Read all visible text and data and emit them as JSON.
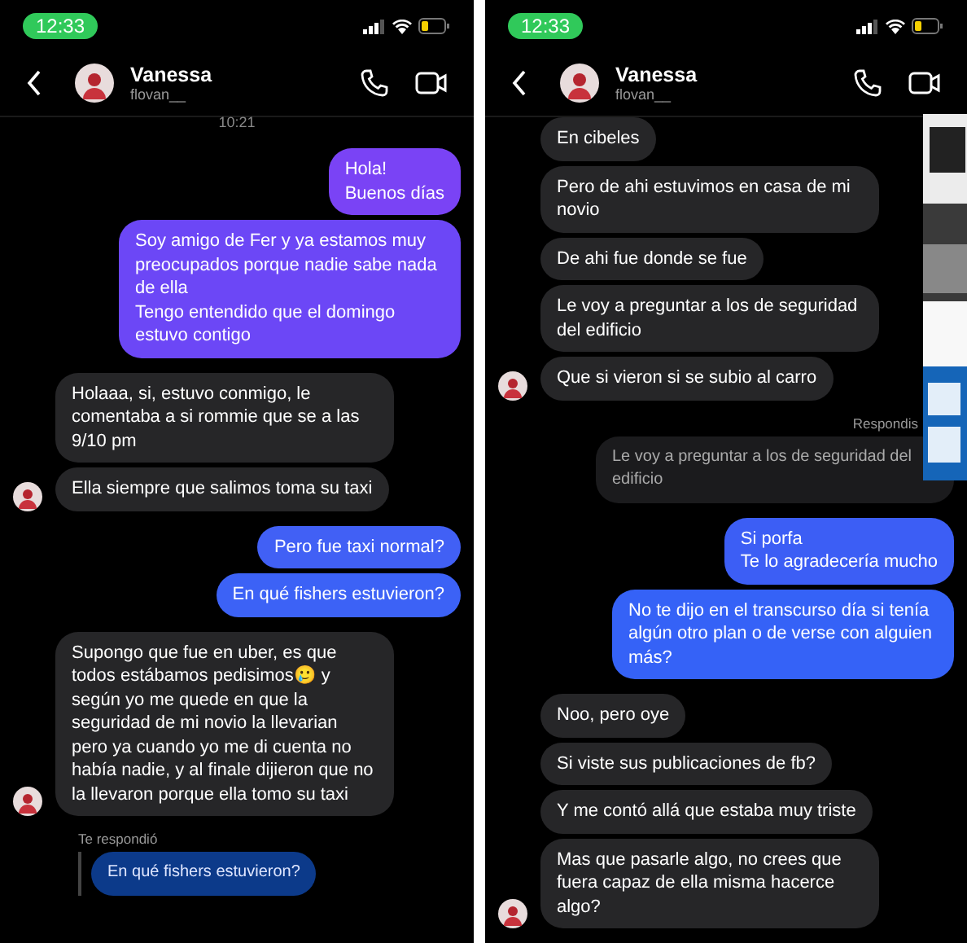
{
  "panels": [
    {
      "status_time": "12:33",
      "contact": {
        "name": "Vanessa",
        "username": "flovan__"
      },
      "messages": [
        {
          "kind": "timestamp",
          "text": "10:21"
        },
        {
          "kind": "sent",
          "text": "Hola!\nBuenos días",
          "color": "#7a43f5"
        },
        {
          "kind": "sent",
          "text": "Soy amigo de Fer y ya estamos muy preocupados porque nadie sabe nada de ella\nTengo entendido que el domingo estuvo contigo",
          "color": "#6c47f6"
        },
        {
          "kind": "received",
          "text": "Holaaa, si, estuvo conmigo, le comentaba a si rommie que se a las 9/10 pm",
          "avatar": false
        },
        {
          "kind": "received",
          "text": "Ella siempre que salimos toma su taxi",
          "avatar": true
        },
        {
          "kind": "sent",
          "text": "Pero fue taxi normal?",
          "color": "#4160f5"
        },
        {
          "kind": "sent",
          "text": "En qué fishers estuvieron?",
          "color": "#3c62f6"
        },
        {
          "kind": "received",
          "text": "Supongo que fue en uber, es que todos estábamos pedisimos🥲 y según yo me quede en que la seguridad de mi novio la llevarian pero ya cuando yo me di cuenta no había nadie, y al finale dijieron que no la llevaron porque ella tomo su taxi",
          "avatar": true
        },
        {
          "kind": "incoming_note",
          "text": "Te respondió"
        },
        {
          "kind": "incoming_quote",
          "text": "En qué fishers estuvieron?",
          "color": "#0c3a8a"
        }
      ]
    },
    {
      "status_time": "12:33",
      "contact": {
        "name": "Vanessa",
        "username": "flovan__"
      },
      "messages": [
        {
          "kind": "received",
          "text": "En cibeles",
          "avatar": false
        },
        {
          "kind": "received",
          "text": "Pero de ahi estuvimos en casa de mi novio",
          "avatar": false
        },
        {
          "kind": "received",
          "text": "De ahi fue donde se fue",
          "avatar": false
        },
        {
          "kind": "received",
          "text": "Le voy a preguntar a los de seguridad del edificio",
          "avatar": false
        },
        {
          "kind": "received",
          "text": "Que si vieron si se subio al carro",
          "avatar": true
        },
        {
          "kind": "outgoing_note",
          "text": "Respondis"
        },
        {
          "kind": "outgoing_quote",
          "text": "Le voy a preguntar a los de seguridad del edificio",
          "color": "#1b1b1d"
        },
        {
          "kind": "sent",
          "text": "Si porfa\nTe lo agradecería mucho",
          "color": "#3c5ef5"
        },
        {
          "kind": "sent",
          "text": "No te dijo en el transcurso día si tenía algún otro plan o de verse con alguien más?",
          "color": "#3562f7"
        },
        {
          "kind": "received",
          "text": "Noo, pero oye",
          "avatar": false
        },
        {
          "kind": "received",
          "text": "Si viste sus publicaciones de fb?",
          "avatar": false
        },
        {
          "kind": "received",
          "text": "Y me contó allá que estaba muy triste",
          "avatar": false
        },
        {
          "kind": "received",
          "text": "Mas que pasarle algo, no crees que fuera capaz de ella misma hacerce algo?",
          "avatar": true
        }
      ]
    }
  ]
}
